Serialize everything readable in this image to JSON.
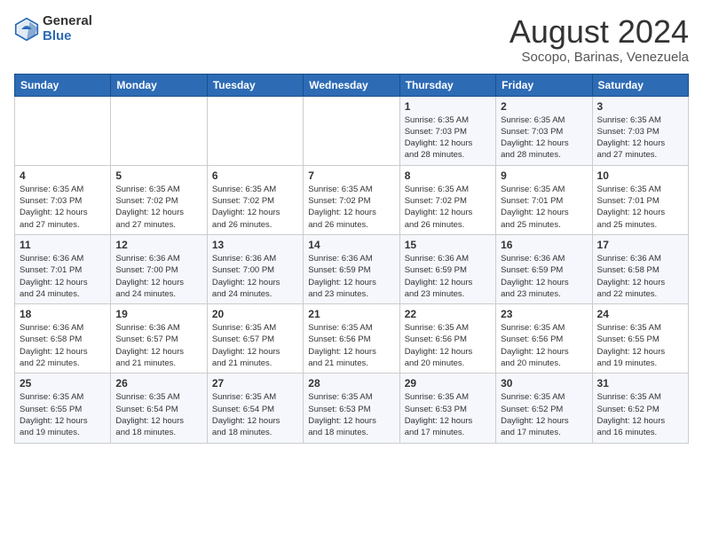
{
  "logo": {
    "general": "General",
    "blue": "Blue"
  },
  "title": {
    "month_year": "August 2024",
    "location": "Socopo, Barinas, Venezuela"
  },
  "weekdays": [
    "Sunday",
    "Monday",
    "Tuesday",
    "Wednesday",
    "Thursday",
    "Friday",
    "Saturday"
  ],
  "weeks": [
    [
      {
        "day": "",
        "info": ""
      },
      {
        "day": "",
        "info": ""
      },
      {
        "day": "",
        "info": ""
      },
      {
        "day": "",
        "info": ""
      },
      {
        "day": "1",
        "info": "Sunrise: 6:35 AM\nSunset: 7:03 PM\nDaylight: 12 hours\nand 28 minutes."
      },
      {
        "day": "2",
        "info": "Sunrise: 6:35 AM\nSunset: 7:03 PM\nDaylight: 12 hours\nand 28 minutes."
      },
      {
        "day": "3",
        "info": "Sunrise: 6:35 AM\nSunset: 7:03 PM\nDaylight: 12 hours\nand 27 minutes."
      }
    ],
    [
      {
        "day": "4",
        "info": "Sunrise: 6:35 AM\nSunset: 7:03 PM\nDaylight: 12 hours\nand 27 minutes."
      },
      {
        "day": "5",
        "info": "Sunrise: 6:35 AM\nSunset: 7:02 PM\nDaylight: 12 hours\nand 27 minutes."
      },
      {
        "day": "6",
        "info": "Sunrise: 6:35 AM\nSunset: 7:02 PM\nDaylight: 12 hours\nand 26 minutes."
      },
      {
        "day": "7",
        "info": "Sunrise: 6:35 AM\nSunset: 7:02 PM\nDaylight: 12 hours\nand 26 minutes."
      },
      {
        "day": "8",
        "info": "Sunrise: 6:35 AM\nSunset: 7:02 PM\nDaylight: 12 hours\nand 26 minutes."
      },
      {
        "day": "9",
        "info": "Sunrise: 6:35 AM\nSunset: 7:01 PM\nDaylight: 12 hours\nand 25 minutes."
      },
      {
        "day": "10",
        "info": "Sunrise: 6:35 AM\nSunset: 7:01 PM\nDaylight: 12 hours\nand 25 minutes."
      }
    ],
    [
      {
        "day": "11",
        "info": "Sunrise: 6:36 AM\nSunset: 7:01 PM\nDaylight: 12 hours\nand 24 minutes."
      },
      {
        "day": "12",
        "info": "Sunrise: 6:36 AM\nSunset: 7:00 PM\nDaylight: 12 hours\nand 24 minutes."
      },
      {
        "day": "13",
        "info": "Sunrise: 6:36 AM\nSunset: 7:00 PM\nDaylight: 12 hours\nand 24 minutes."
      },
      {
        "day": "14",
        "info": "Sunrise: 6:36 AM\nSunset: 6:59 PM\nDaylight: 12 hours\nand 23 minutes."
      },
      {
        "day": "15",
        "info": "Sunrise: 6:36 AM\nSunset: 6:59 PM\nDaylight: 12 hours\nand 23 minutes."
      },
      {
        "day": "16",
        "info": "Sunrise: 6:36 AM\nSunset: 6:59 PM\nDaylight: 12 hours\nand 23 minutes."
      },
      {
        "day": "17",
        "info": "Sunrise: 6:36 AM\nSunset: 6:58 PM\nDaylight: 12 hours\nand 22 minutes."
      }
    ],
    [
      {
        "day": "18",
        "info": "Sunrise: 6:36 AM\nSunset: 6:58 PM\nDaylight: 12 hours\nand 22 minutes."
      },
      {
        "day": "19",
        "info": "Sunrise: 6:36 AM\nSunset: 6:57 PM\nDaylight: 12 hours\nand 21 minutes."
      },
      {
        "day": "20",
        "info": "Sunrise: 6:35 AM\nSunset: 6:57 PM\nDaylight: 12 hours\nand 21 minutes."
      },
      {
        "day": "21",
        "info": "Sunrise: 6:35 AM\nSunset: 6:56 PM\nDaylight: 12 hours\nand 21 minutes."
      },
      {
        "day": "22",
        "info": "Sunrise: 6:35 AM\nSunset: 6:56 PM\nDaylight: 12 hours\nand 20 minutes."
      },
      {
        "day": "23",
        "info": "Sunrise: 6:35 AM\nSunset: 6:56 PM\nDaylight: 12 hours\nand 20 minutes."
      },
      {
        "day": "24",
        "info": "Sunrise: 6:35 AM\nSunset: 6:55 PM\nDaylight: 12 hours\nand 19 minutes."
      }
    ],
    [
      {
        "day": "25",
        "info": "Sunrise: 6:35 AM\nSunset: 6:55 PM\nDaylight: 12 hours\nand 19 minutes."
      },
      {
        "day": "26",
        "info": "Sunrise: 6:35 AM\nSunset: 6:54 PM\nDaylight: 12 hours\nand 18 minutes."
      },
      {
        "day": "27",
        "info": "Sunrise: 6:35 AM\nSunset: 6:54 PM\nDaylight: 12 hours\nand 18 minutes."
      },
      {
        "day": "28",
        "info": "Sunrise: 6:35 AM\nSunset: 6:53 PM\nDaylight: 12 hours\nand 18 minutes."
      },
      {
        "day": "29",
        "info": "Sunrise: 6:35 AM\nSunset: 6:53 PM\nDaylight: 12 hours\nand 17 minutes."
      },
      {
        "day": "30",
        "info": "Sunrise: 6:35 AM\nSunset: 6:52 PM\nDaylight: 12 hours\nand 17 minutes."
      },
      {
        "day": "31",
        "info": "Sunrise: 6:35 AM\nSunset: 6:52 PM\nDaylight: 12 hours\nand 16 minutes."
      }
    ]
  ]
}
